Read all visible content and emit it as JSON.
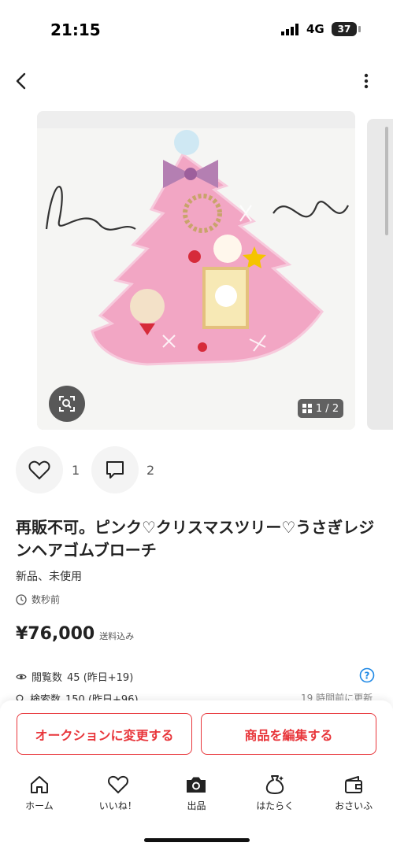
{
  "status_bar": {
    "time": "21:15",
    "network": "4G",
    "battery": "37"
  },
  "nav": {
    "back_icon": "chevron-left-icon",
    "more_icon": "vertical-dots-icon"
  },
  "gallery": {
    "counter": "1 / 2",
    "image_description": "pink resin christmas tree brooch"
  },
  "actions": {
    "like_count": "1",
    "comment_count": "2"
  },
  "item": {
    "title": "再販不可。ピンク♡クリスマスツリー♡うさぎレジンヘアゴムブローチ",
    "condition": "新品、未使用",
    "posted": "数秒前",
    "price": "¥76,000",
    "price_note": "送料込み"
  },
  "stats": {
    "views": "閲覧数",
    "views_value": "45 (昨日+19)",
    "searches": "検索数",
    "searches_value": "150 (昨日+96)",
    "updated": "19 時間前に更新"
  },
  "buttons": {
    "auction": "オークションに変更する",
    "edit": "商品を編集する"
  },
  "tabs": [
    {
      "label": "ホーム",
      "icon": "home-icon"
    },
    {
      "label": "いいね！",
      "icon": "heart-icon"
    },
    {
      "label": "出品",
      "icon": "camera-icon"
    },
    {
      "label": "はたらく",
      "icon": "money-bag-icon"
    },
    {
      "label": "おさいふ",
      "icon": "wallet-icon"
    }
  ],
  "colors": {
    "accent": "#e8363b",
    "brooch_pink": "#f2a6c4"
  }
}
